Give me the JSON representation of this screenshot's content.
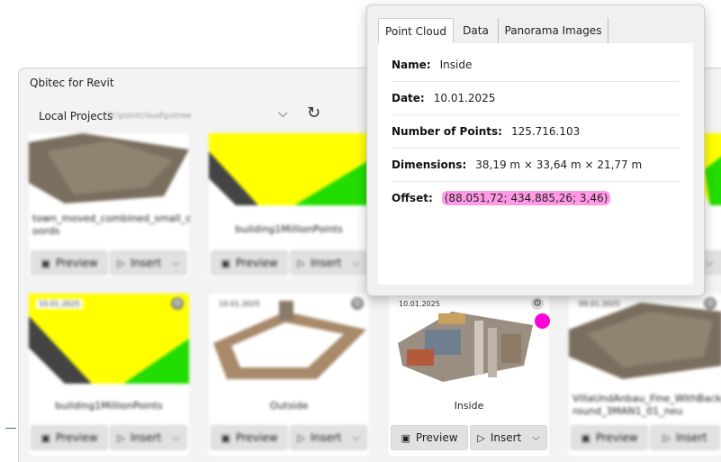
{
  "app": {
    "title": "Qbitec for Revit"
  },
  "projects": {
    "label": "Local Projects",
    "path": "D:\\pointcloud\\potree"
  },
  "cards_top": [
    {
      "name": "town_moved_combined_small_c oords",
      "preview": "Preview",
      "insert": "Insert"
    },
    {
      "name": "building1MillionPoints",
      "preview": "Preview",
      "insert": "Insert"
    }
  ],
  "cards_bottom": [
    {
      "date": "10.01.2025",
      "name": "building1MillionPoints",
      "preview": "Preview",
      "insert": "Insert"
    },
    {
      "date": "10.01.2025",
      "name": "Outside",
      "preview": "Preview",
      "insert": "Insert"
    },
    {
      "date": "10.01.2025",
      "name": "Inside",
      "preview": "Preview",
      "insert": "Insert"
    },
    {
      "date": "09.01.2025",
      "name": "VillaUndAnbau_Fine_WithBackg round_3MAN1_01_neu",
      "preview": "Preview",
      "insert": "Insert"
    }
  ],
  "popup": {
    "tabs": [
      "Point Cloud",
      "Data",
      "Panorama Images"
    ],
    "active_tab": "Point Cloud",
    "fields": [
      {
        "label": "Name:",
        "value": "Inside"
      },
      {
        "label": "Date:",
        "value": "10.01.2025"
      },
      {
        "label": "Number of Points:",
        "value": "125.716.103"
      },
      {
        "label": "Dimensions:",
        "value": "38,19 m × 33,64 m × 21,77 m"
      },
      {
        "label": "Offset:",
        "value": "(88.051,72; 434.885,26; 3,46)"
      }
    ]
  },
  "colors": {
    "highlight": "#ff99e6",
    "marker": "#ff00d8",
    "yellow": "#ffff00",
    "green": "#22dd00"
  }
}
